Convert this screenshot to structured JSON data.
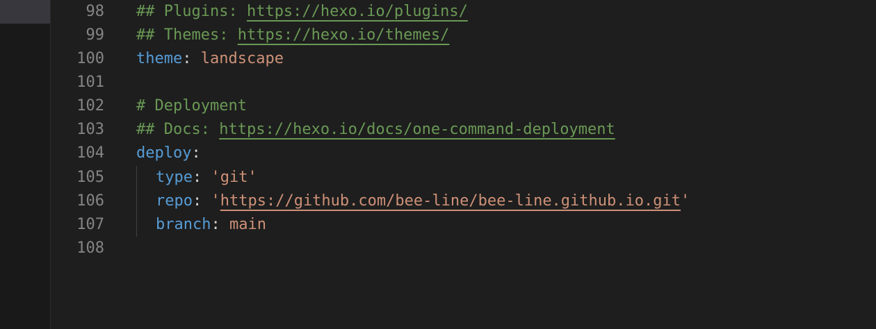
{
  "line_numbers": [
    "98",
    "99",
    "100",
    "101",
    "102",
    "103",
    "104",
    "105",
    "106",
    "107",
    "108"
  ],
  "lines": {
    "l98": {
      "comment_prefix": "## Plugins: ",
      "url": "https://hexo.io/plugins/"
    },
    "l99": {
      "comment_prefix": "## Themes: ",
      "url": "https://hexo.io/themes/"
    },
    "l100": {
      "key": "theme",
      "colon": ": ",
      "value": "landscape"
    },
    "l102": {
      "comment": "# Deployment"
    },
    "l103": {
      "comment_prefix": "## Docs: ",
      "url": "https://hexo.io/docs/one-command-deployment"
    },
    "l104": {
      "key": "deploy",
      "colon": ":"
    },
    "l105": {
      "key": "type",
      "colon": ": ",
      "value": "'git'"
    },
    "l106": {
      "key": "repo",
      "colon": ": ",
      "quote_open": "'",
      "url": "https://github.com/bee-line/bee-line.github.io.git",
      "quote_close": "'"
    },
    "l107": {
      "key": "branch",
      "colon": ": ",
      "value": "main"
    }
  },
  "colors": {
    "background": "#1e1e1e",
    "comment": "#6a9955",
    "key": "#569cd6",
    "string": "#ce9178",
    "line_number": "#858585"
  }
}
